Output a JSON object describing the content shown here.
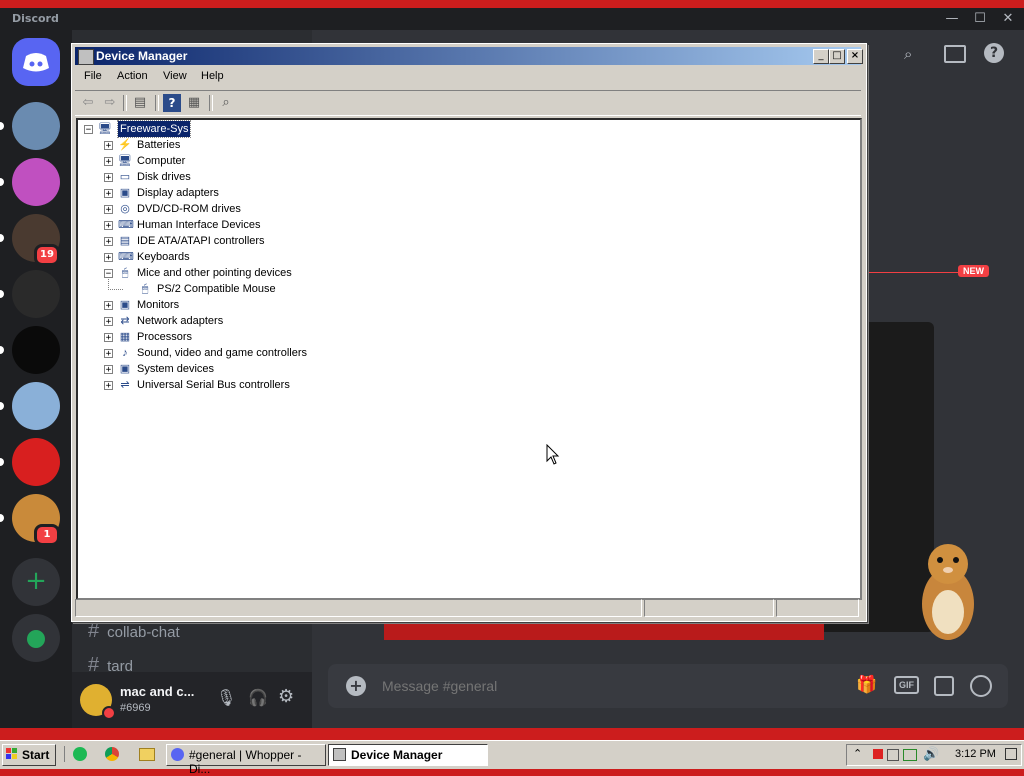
{
  "discord": {
    "title": "Discord",
    "window_controls": [
      "—",
      "☐",
      "✕"
    ],
    "servers": [
      {
        "name": "server-1",
        "color": "#6a8bb0"
      },
      {
        "name": "server-2",
        "color": "#c050c0"
      },
      {
        "name": "server-3",
        "color": "#4a3a30",
        "badge": "19"
      },
      {
        "name": "server-4",
        "color": "#2a2a2a"
      },
      {
        "name": "server-5",
        "color": "#0a0a0a"
      },
      {
        "name": "server-6",
        "color": "#8ab0d8"
      },
      {
        "name": "server-7",
        "color": "#d81f1f"
      },
      {
        "name": "server-8",
        "color": "#c98a3a",
        "badge": "1"
      }
    ],
    "channels": [
      "collab-chat",
      "tard"
    ],
    "user": {
      "name": "mac and c...",
      "tag": "#6969"
    },
    "new_label": "NEW",
    "message_placeholder": "Message #general",
    "chat_actions": [
      "gift-icon",
      "gif-icon",
      "sticker-icon",
      "emoji-icon"
    ],
    "gif_label": "GIF"
  },
  "device_manager": {
    "title": "Device Manager",
    "menu": [
      "File",
      "Action",
      "View",
      "Help"
    ],
    "root": "Freeware-Sys",
    "tree": [
      {
        "label": "Batteries",
        "expander": "+",
        "icon": "⚡"
      },
      {
        "label": "Computer",
        "expander": "+",
        "icon": "🖥"
      },
      {
        "label": "Disk drives",
        "expander": "+",
        "icon": "▭"
      },
      {
        "label": "Display adapters",
        "expander": "+",
        "icon": "▣"
      },
      {
        "label": "DVD/CD-ROM drives",
        "expander": "+",
        "icon": "◎"
      },
      {
        "label": "Human Interface Devices",
        "expander": "+",
        "icon": "⌨"
      },
      {
        "label": "IDE ATA/ATAPI controllers",
        "expander": "+",
        "icon": "▤"
      },
      {
        "label": "Keyboards",
        "expander": "+",
        "icon": "⌨"
      },
      {
        "label": "Mice and other pointing devices",
        "expander": "−",
        "icon": "🖱"
      },
      {
        "label": "PS/2 Compatible Mouse",
        "child": true,
        "icon": "🖱"
      },
      {
        "label": "Monitors",
        "expander": "+",
        "icon": "▣"
      },
      {
        "label": "Network adapters",
        "expander": "+",
        "icon": "⇄"
      },
      {
        "label": "Processors",
        "expander": "+",
        "icon": "▦"
      },
      {
        "label": "Sound, video and game controllers",
        "expander": "+",
        "icon": "♪"
      },
      {
        "label": "System devices",
        "expander": "+",
        "icon": "▣"
      },
      {
        "label": "Universal Serial Bus controllers",
        "expander": "+",
        "icon": "⇌"
      }
    ]
  },
  "taskbar": {
    "start_label": "Start",
    "tasks": [
      {
        "label": "#general | Whopper - Di...",
        "icon": "discord-icon",
        "active": false
      },
      {
        "label": "Device Manager",
        "icon": "device-manager-icon",
        "active": true
      }
    ],
    "clock": "3:12 PM"
  }
}
